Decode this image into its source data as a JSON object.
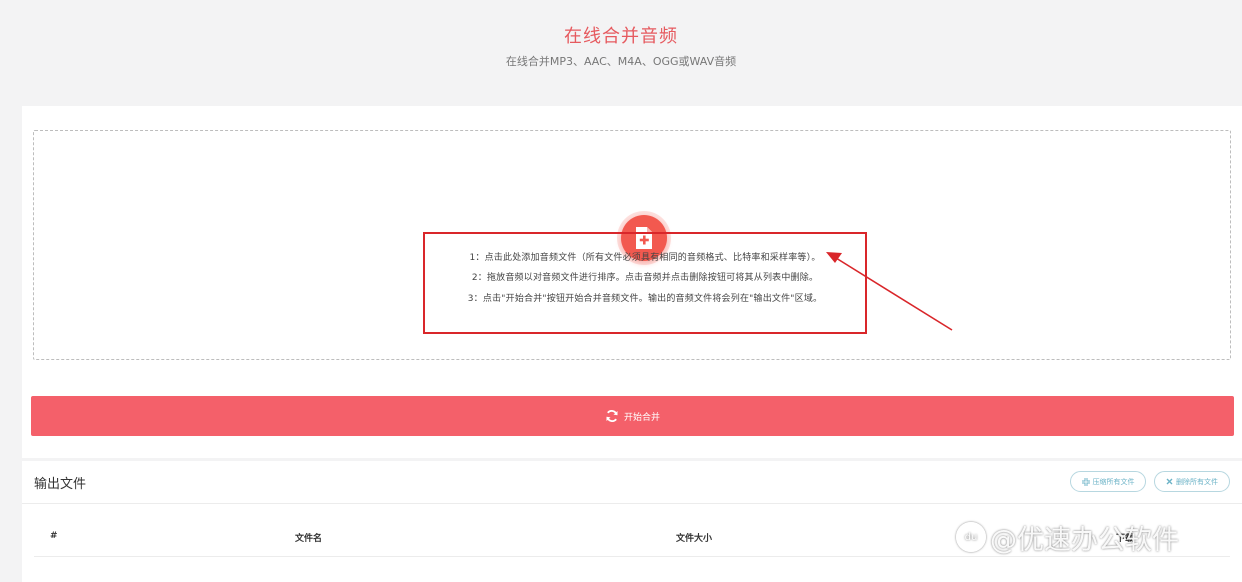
{
  "header": {
    "title": "在线合并音频",
    "subtitle": "在线合并MP3、AAC、M4A、OGG或WAV音频"
  },
  "upload": {
    "add_icon": "file-plus-icon",
    "instructions": [
      "1：点击此处添加音频文件（所有文件必须具有相同的音频格式、比特率和采样率等）。",
      "2：拖放音频以对音频文件进行排序。点击音频并点击删除按钮可将其从列表中删除。",
      "3：点击\"开始合并\"按钮开始合并音频文件。输出的音频文件将会列在\"输出文件\"区域。"
    ],
    "merge_button": "开始合并",
    "merge_icon": "refresh-icon"
  },
  "output": {
    "title": "输出文件",
    "compress_all": "压缩所有文件",
    "delete_all": "删除所有文件",
    "columns": [
      "#",
      "文件名",
      "文件大小",
      "下载"
    ]
  },
  "watermark": {
    "text": "@优速办公软件",
    "logo_text": "du"
  },
  "colors": {
    "accent": "#f4606a",
    "title": "#e65a5f",
    "annotation": "#d9262a",
    "pill": "#6cb3c7"
  }
}
